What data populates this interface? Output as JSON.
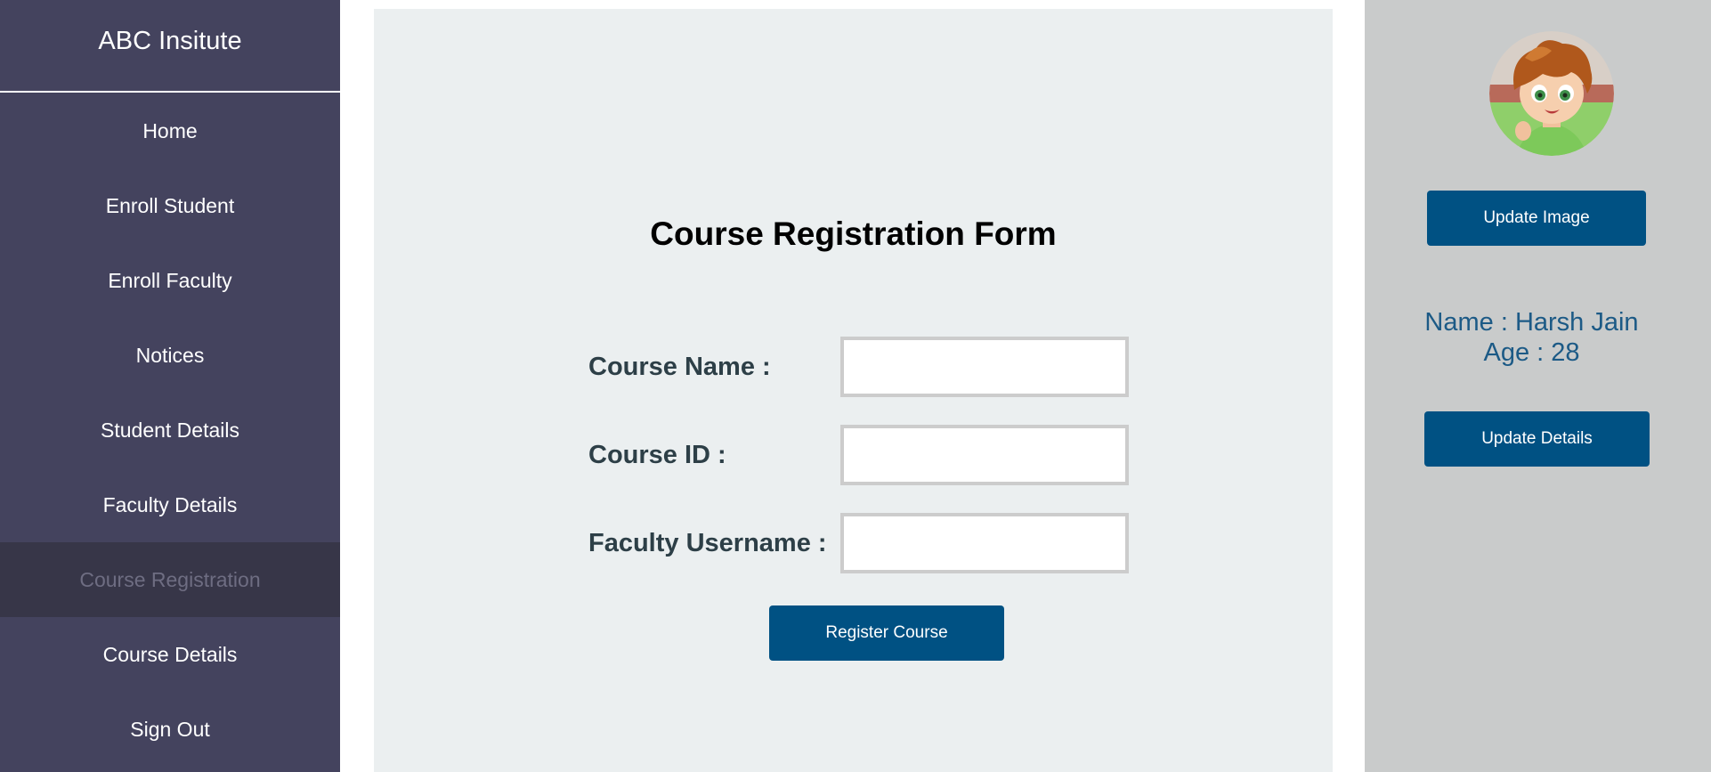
{
  "sidebar": {
    "brand": "ABC Insitute",
    "items": [
      {
        "label": "Home",
        "active": false
      },
      {
        "label": "Enroll Student",
        "active": false
      },
      {
        "label": "Enroll Faculty",
        "active": false
      },
      {
        "label": "Notices",
        "active": false
      },
      {
        "label": "Student Details",
        "active": false
      },
      {
        "label": "Faculty Details",
        "active": false
      },
      {
        "label": "Course Registration",
        "active": true
      },
      {
        "label": "Course Details",
        "active": false
      },
      {
        "label": "Sign Out",
        "active": false
      }
    ]
  },
  "form": {
    "title": "Course Registration Form",
    "course_name_label": "Course Name :",
    "course_name_value": "",
    "course_id_label": "Course ID :",
    "course_id_value": "",
    "faculty_username_label": "Faculty Username :",
    "faculty_username_value": "",
    "submit_label": "Register Course"
  },
  "profile": {
    "avatar_icon": "cartoon-boy-avatar",
    "update_image_label": "Update Image",
    "name_line": "Name : Harsh Jain",
    "age_line": "Age : 28",
    "update_details_label": "Update Details"
  },
  "colors": {
    "sidebar_bg": "#44435e",
    "sidebar_active_bg": "#373648",
    "form_panel_bg": "#ebeff0",
    "profile_bg": "#c9cbcb",
    "button_bg": "#005183",
    "profile_text": "#1c5a86"
  }
}
